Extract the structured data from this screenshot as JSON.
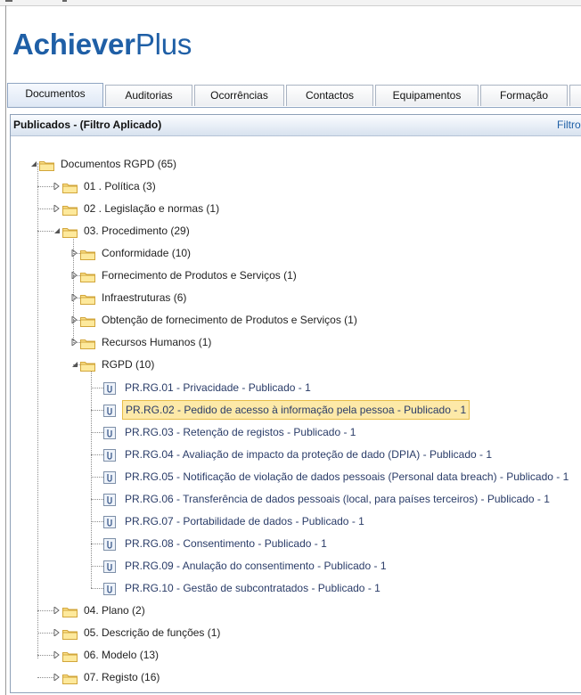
{
  "app": {
    "logo_bold": "Achiever",
    "logo_regular": "Plus"
  },
  "tabs": [
    {
      "label": "Documentos"
    },
    {
      "label": "Auditorias"
    },
    {
      "label": "Ocorrências"
    },
    {
      "label": "Contactos"
    },
    {
      "label": "Equipamentos"
    },
    {
      "label": "Formação"
    }
  ],
  "panel": {
    "title": "Publicados - (Filtro Aplicado)",
    "filter_link": "Filtro"
  },
  "tree": {
    "root": "Documentos RGPD (65)",
    "folders": [
      {
        "label": "01 . Política (3)"
      },
      {
        "label": "02 . Legislação e normas (1)"
      },
      {
        "label": "03. Procedimento (29)"
      },
      {
        "label": "04. Plano (2)"
      },
      {
        "label": "05. Descrição de funções (1)"
      },
      {
        "label": "06. Modelo (13)"
      },
      {
        "label": "07. Registo (16)"
      }
    ],
    "procedimento_subfolders": [
      {
        "label": "Conformidade (10)"
      },
      {
        "label": "Fornecimento de Produtos e Serviços (1)"
      },
      {
        "label": "Infraestruturas (6)"
      },
      {
        "label": "Obtenção de fornecimento de Produtos e Serviços (1)"
      },
      {
        "label": "Recursos Humanos (1)"
      },
      {
        "label": "RGPD (10)"
      }
    ],
    "rgpd_documents": [
      {
        "label": "PR.RG.01 - Privacidade - Publicado - 1"
      },
      {
        "label": "PR.RG.02 - Pedido de acesso à informação pela pessoa - Publicado - 1"
      },
      {
        "label": "PR.RG.03 - Retenção de registos - Publicado - 1"
      },
      {
        "label": "PR.RG.04 - Avaliação de impacto da proteção de dado (DPIA) - Publicado - 1"
      },
      {
        "label": "PR.RG.05 - Notificação de violação de dados pessoais (Personal data breach) - Publicado - 1"
      },
      {
        "label": "PR.RG.06 - Transferência de dados pessoais (local, para países terceiros) - Publicado - 1"
      },
      {
        "label": "PR.RG.07 - Portabilidade de dados - Publicado - 1"
      },
      {
        "label": "PR.RG.08 - Consentimento - Publicado - 1"
      },
      {
        "label": "PR.RG.09 - Anulação do consentimento - Publicado - 1"
      },
      {
        "label": "PR.RG.10 - Gestão de subcontratados - Publicado - 1"
      }
    ],
    "selected_document": "PR.RG.02 - Pedido de acesso à informação pela pessoa - Publicado - 1"
  },
  "icons": {
    "folder": "folder-icon",
    "document": "document-icon",
    "expanded": "expanded-triangle-icon",
    "collapsed": "collapsed-triangle-icon"
  },
  "colors": {
    "brand": "#1f5fa6",
    "selection_fill": "#fde9a8",
    "selection_border": "#e7bd48",
    "document_text": "#2a3c68",
    "header_gradient_end": "#d8e2ef"
  }
}
